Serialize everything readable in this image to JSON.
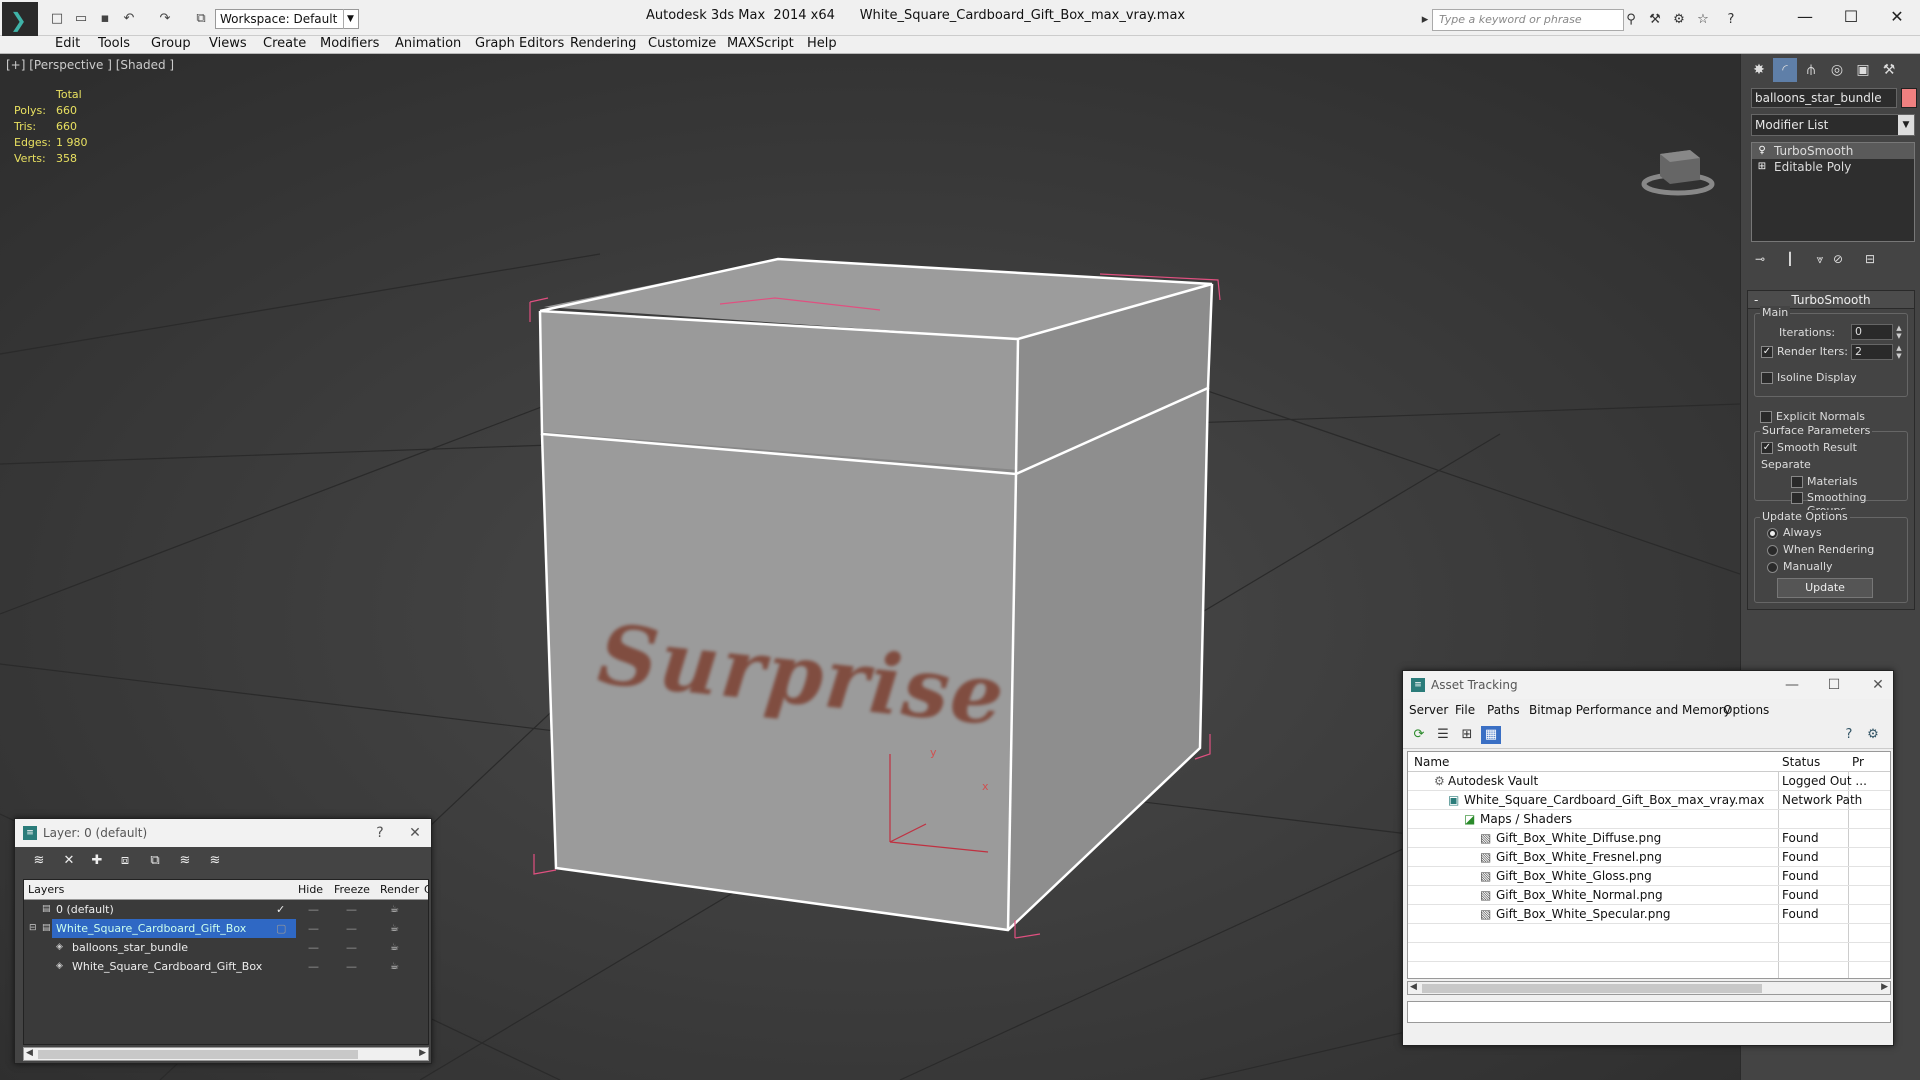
{
  "app": {
    "title": "Autodesk 3ds Max  2014 x64",
    "file": "White_Square_Cardboard_Gift_Box_max_vray.max",
    "workspace": "Workspace: Default",
    "search_placeholder": "Type a keyword or phrase"
  },
  "menu": [
    "Edit",
    "Tools",
    "Group",
    "Views",
    "Create",
    "Modifiers",
    "Animation",
    "Graph Editors",
    "Rendering",
    "Customize",
    "MAXScript",
    "Help"
  ],
  "viewport": {
    "label": "[+] [Perspective ] [Shaded ]",
    "stats": {
      "header": "Total",
      "rows": [
        {
          "k": "Polys:",
          "v": "660"
        },
        {
          "k": "Tris:",
          "v": "660"
        },
        {
          "k": "Edges:",
          "v": "1 980"
        },
        {
          "k": "Verts:",
          "v": "358"
        }
      ]
    },
    "texture_text": "Surprise",
    "axis_y": "y",
    "axis_x": "x"
  },
  "command_panel": {
    "object_name": "balloons_star_bundle",
    "object_color": "#f08080",
    "modifier_list": "Modifier List",
    "stack": [
      "TurboSmooth",
      "Editable Poly"
    ],
    "rollout_title": "TurboSmooth",
    "main_group": "Main",
    "iterations_label": "Iterations:",
    "iterations_value": "0",
    "render_iters_label": "Render Iters:",
    "render_iters_value": "2",
    "isoline": "Isoline Display",
    "explicit_normals": "Explicit Normals",
    "surface_group": "Surface Parameters",
    "smooth_result": "Smooth Result",
    "separate": "Separate",
    "materials": "Materials",
    "smoothing_groups": "Smoothing Groups",
    "update_group": "Update Options",
    "always": "Always",
    "when_rendering": "When Rendering",
    "manually": "Manually",
    "update_btn": "Update"
  },
  "layer_panel": {
    "title": "Layer: 0 (default)",
    "help": "?",
    "close": "✕",
    "columns": {
      "layers": "Layers",
      "hide": "Hide",
      "freeze": "Freeze",
      "render": "Render",
      "extra": "C"
    },
    "rows": [
      {
        "name": "0 (default)"
      },
      {
        "name": "White_Square_Cardboard_Gift_Box"
      },
      {
        "name": "balloons_star_bundle"
      },
      {
        "name": "White_Square_Cardboard_Gift_Box"
      }
    ]
  },
  "asset_panel": {
    "title": "Asset Tracking",
    "menu": [
      "Server",
      "File",
      "Paths",
      "Bitmap Performance and Memory",
      "Options"
    ],
    "columns": {
      "name": "Name",
      "status": "Status",
      "extra": "Pr"
    },
    "rows": [
      {
        "name": "Autodesk Vault",
        "status": "Logged Out ..."
      },
      {
        "name": "White_Square_Cardboard_Gift_Box_max_vray.max",
        "status": "Network Path"
      },
      {
        "name": "Maps / Shaders",
        "status": ""
      },
      {
        "name": "Gift_Box_White_Diffuse.png",
        "status": "Found"
      },
      {
        "name": "Gift_Box_White_Fresnel.png",
        "status": "Found"
      },
      {
        "name": "Gift_Box_White_Gloss.png",
        "status": "Found"
      },
      {
        "name": "Gift_Box_White_Normal.png",
        "status": "Found"
      },
      {
        "name": "Gift_Box_White_Specular.png",
        "status": "Found"
      }
    ]
  }
}
